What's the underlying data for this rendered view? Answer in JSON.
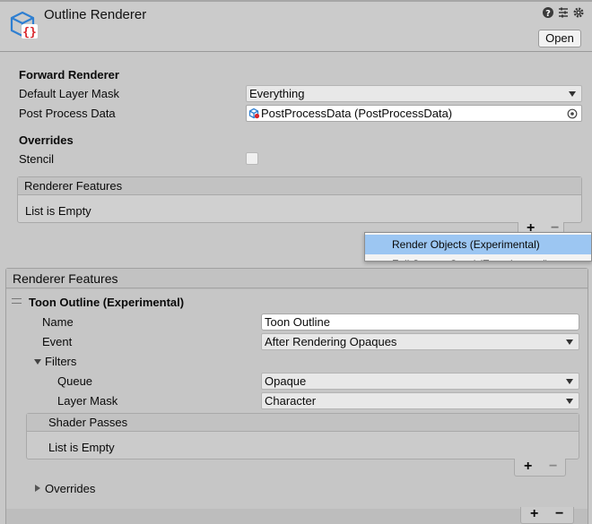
{
  "header": {
    "title": "Outline Renderer",
    "open_button": "Open",
    "icons": [
      "asset-icon",
      "help-icon",
      "preset-icon",
      "settings-icon"
    ]
  },
  "forward_renderer": {
    "heading": "Forward Renderer",
    "default_layer_mask_label": "Default Layer Mask",
    "default_layer_mask_value": "Everything",
    "post_process_label": "Post Process Data",
    "post_process_value": "PostProcessData (PostProcessData)",
    "overrides_heading": "Overrides",
    "stencil_label": "Stencil",
    "stencil_checked": false
  },
  "renderer_features_top": {
    "header": "Renderer Features",
    "empty_text": "List is Empty",
    "add": "+",
    "remove": "−"
  },
  "popup": {
    "items": [
      "Render Objects (Experimental)",
      "Full Screen Quad (Experimental)"
    ],
    "selected_index": 0
  },
  "renderer_features": {
    "header": "Renderer Features",
    "feature_title": "Toon Outline (Experimental)",
    "name_label": "Name",
    "name_value": "Toon Outline",
    "event_label": "Event",
    "event_value": "After Rendering Opaques",
    "filters_label": "Filters",
    "queue_label": "Queue",
    "queue_value": "Opaque",
    "layer_mask_label": "Layer Mask",
    "layer_mask_value": "Character",
    "shader_passes_header": "Shader Passes",
    "shader_passes_empty": "List is Empty",
    "overrides_label": "Overrides",
    "add": "+",
    "remove": "−"
  },
  "colors": {
    "background": "#c8c8c8",
    "selection": "#9cc6f2",
    "brand_blue": "#2f7fd1",
    "brand_red": "#d9262b"
  }
}
